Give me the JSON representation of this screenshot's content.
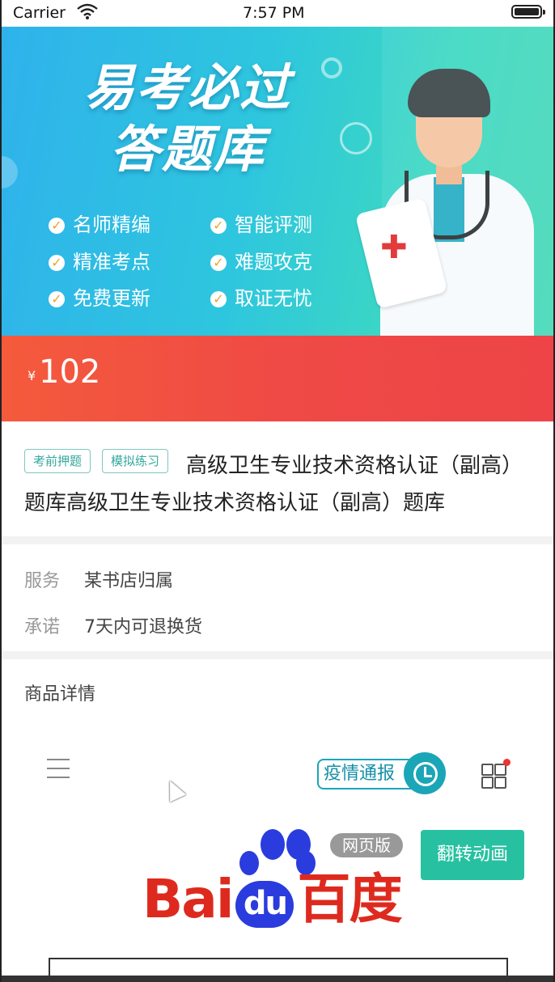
{
  "status_bar": {
    "carrier": "Carrier",
    "time": "7:57 PM"
  },
  "banner": {
    "title_line1": "易考必过",
    "title_line2": "答题库",
    "features": [
      "名师精编",
      "智能评测",
      "精准考点",
      "难题攻克",
      "免费更新",
      "取证无忧"
    ],
    "check_icon": "check-icon",
    "colors": {
      "from": "#2fb2ec",
      "to": "#48d8b8",
      "check": "#f2a22c"
    }
  },
  "price": {
    "currency": "¥",
    "value": "102",
    "color": "#ef4a45"
  },
  "product": {
    "tags": [
      "考前押题",
      "模拟练习"
    ],
    "title": "高级卫生专业技术资格认证（副高）题库高级卫生专业技术资格认证（副高）题库"
  },
  "service": {
    "service_label": "服务",
    "service_value": "某书店归属",
    "promise_label": "承诺",
    "promise_value": "7天内可退换货"
  },
  "detail": {
    "heading": "商品详情"
  },
  "embedded_page": {
    "notice_label": "疫情通报",
    "baidu_text_left": "Bai",
    "baidu_text_du": "du",
    "baidu_text_right": "百度",
    "web_version_badge": "网页版",
    "flip_button": "翻转动画",
    "accent": "#27c1a1",
    "baidu_red": "#de2a1e",
    "baidu_blue": "#2a3cdd"
  }
}
